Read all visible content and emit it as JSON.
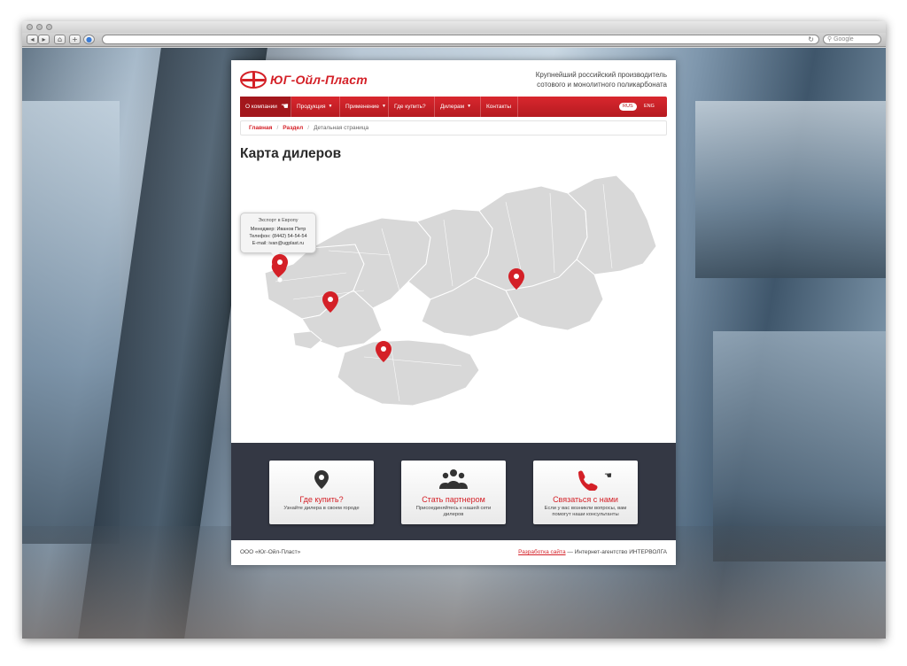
{
  "browser": {
    "search_placeholder": "Google"
  },
  "site": {
    "logo_text": "ЮГ-Ойл-Пласт",
    "tagline_line1": "Крупнейший российский производитель",
    "tagline_line2": "сотового и монолитного поликарбоната"
  },
  "nav": {
    "items": [
      {
        "label": "О компании"
      },
      {
        "label": "Продукция"
      },
      {
        "label": "Применение"
      },
      {
        "label": "Где купить?"
      },
      {
        "label": "Дилерам"
      },
      {
        "label": "Контакты"
      }
    ],
    "lang_ru": "RUS",
    "lang_en": "ENG"
  },
  "breadcrumbs": {
    "home": "Главная",
    "section": "Раздел",
    "current": "Детальная страница",
    "separator": "/"
  },
  "page_title": "Карта дилеров",
  "map": {
    "tooltip": {
      "title": "Экспорт в Европу",
      "manager": "Менеджер: Иванов Петр",
      "phone": "Телефон: (8442) 54-54-54",
      "email": "E-mail: ivan@ugplast.ru"
    },
    "pin_color": "#d42027",
    "land_color": "#d9d9d9"
  },
  "cards": [
    {
      "icon": "location-pin-icon",
      "title": "Где купить?",
      "desc": "Узнайте дилера в своем городе"
    },
    {
      "icon": "people-group-icon",
      "title": "Стать партнером",
      "desc": "Присоединяйтесь к нашей сети дилеров"
    },
    {
      "icon": "phone-icon",
      "title": "Связаться с нами",
      "desc": "Если у вас возникли вопросы, вам помогут наши консультанты"
    }
  ],
  "footer": {
    "copyright": "ООО «Юг-Ойл-Пласт»",
    "dev_link": "Разработка сайта",
    "dev_rest": " — Интернет-агентство ИНТЕРВОЛГА"
  },
  "colors": {
    "accent": "#d42027",
    "band": "#343844"
  }
}
